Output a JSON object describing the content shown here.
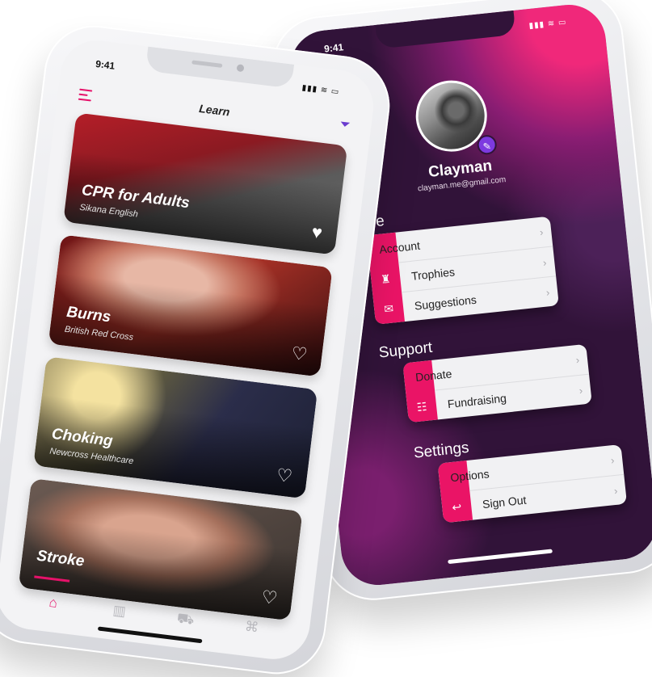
{
  "profile_screen": {
    "time": "9:41",
    "status_icons": "▮▮▮ ≋ ▭",
    "close_icon": "×",
    "user": {
      "name": "Clayman",
      "email": "clayman.me@gmail.com"
    },
    "sections": [
      {
        "title": "Profile",
        "items": [
          {
            "label": "Account",
            "icon": "id-card-icon",
            "glyph": "▤"
          },
          {
            "label": "Trophies",
            "icon": "trophy-icon",
            "glyph": "♜"
          },
          {
            "label": "Suggestions",
            "icon": "mail-icon",
            "glyph": "✉"
          }
        ]
      },
      {
        "title": "Support",
        "items": [
          {
            "label": "Donate",
            "icon": "donate-icon",
            "glyph": "▣"
          },
          {
            "label": "Fundraising",
            "icon": "chat-icon",
            "glyph": "☷"
          }
        ]
      },
      {
        "title": "Settings",
        "items": [
          {
            "label": "Options",
            "icon": "gear-icon",
            "glyph": "⚙"
          },
          {
            "label": "Sign Out",
            "icon": "sign-out-icon",
            "glyph": "↩"
          }
        ]
      }
    ],
    "chevron": "›",
    "accent_color": "#ea1466",
    "background_color": "#311339"
  },
  "learn_screen": {
    "time": "9:41",
    "status_icons": "▮▮▮ ≋ ▭",
    "title": "Learn",
    "courses": [
      {
        "title": "CPR for Adults",
        "source": "Sikana English",
        "favorited": true
      },
      {
        "title": "Burns",
        "source": "British Red Cross",
        "favorited": false
      },
      {
        "title": "Choking",
        "source": "Newcross Healthcare",
        "favorited": false
      },
      {
        "title": "Stroke",
        "source": "",
        "favorited": false
      }
    ],
    "heart_filled": "♥",
    "heart_outline": "♡",
    "tabs": [
      {
        "name": "hospital",
        "glyph": "⌂",
        "active": true
      },
      {
        "name": "clipboard",
        "glyph": "▥",
        "active": false
      },
      {
        "name": "ambulance",
        "glyph": "⛟",
        "active": false
      },
      {
        "name": "network",
        "glyph": "⌘",
        "active": false
      }
    ],
    "accent_color": "#e6126a"
  }
}
